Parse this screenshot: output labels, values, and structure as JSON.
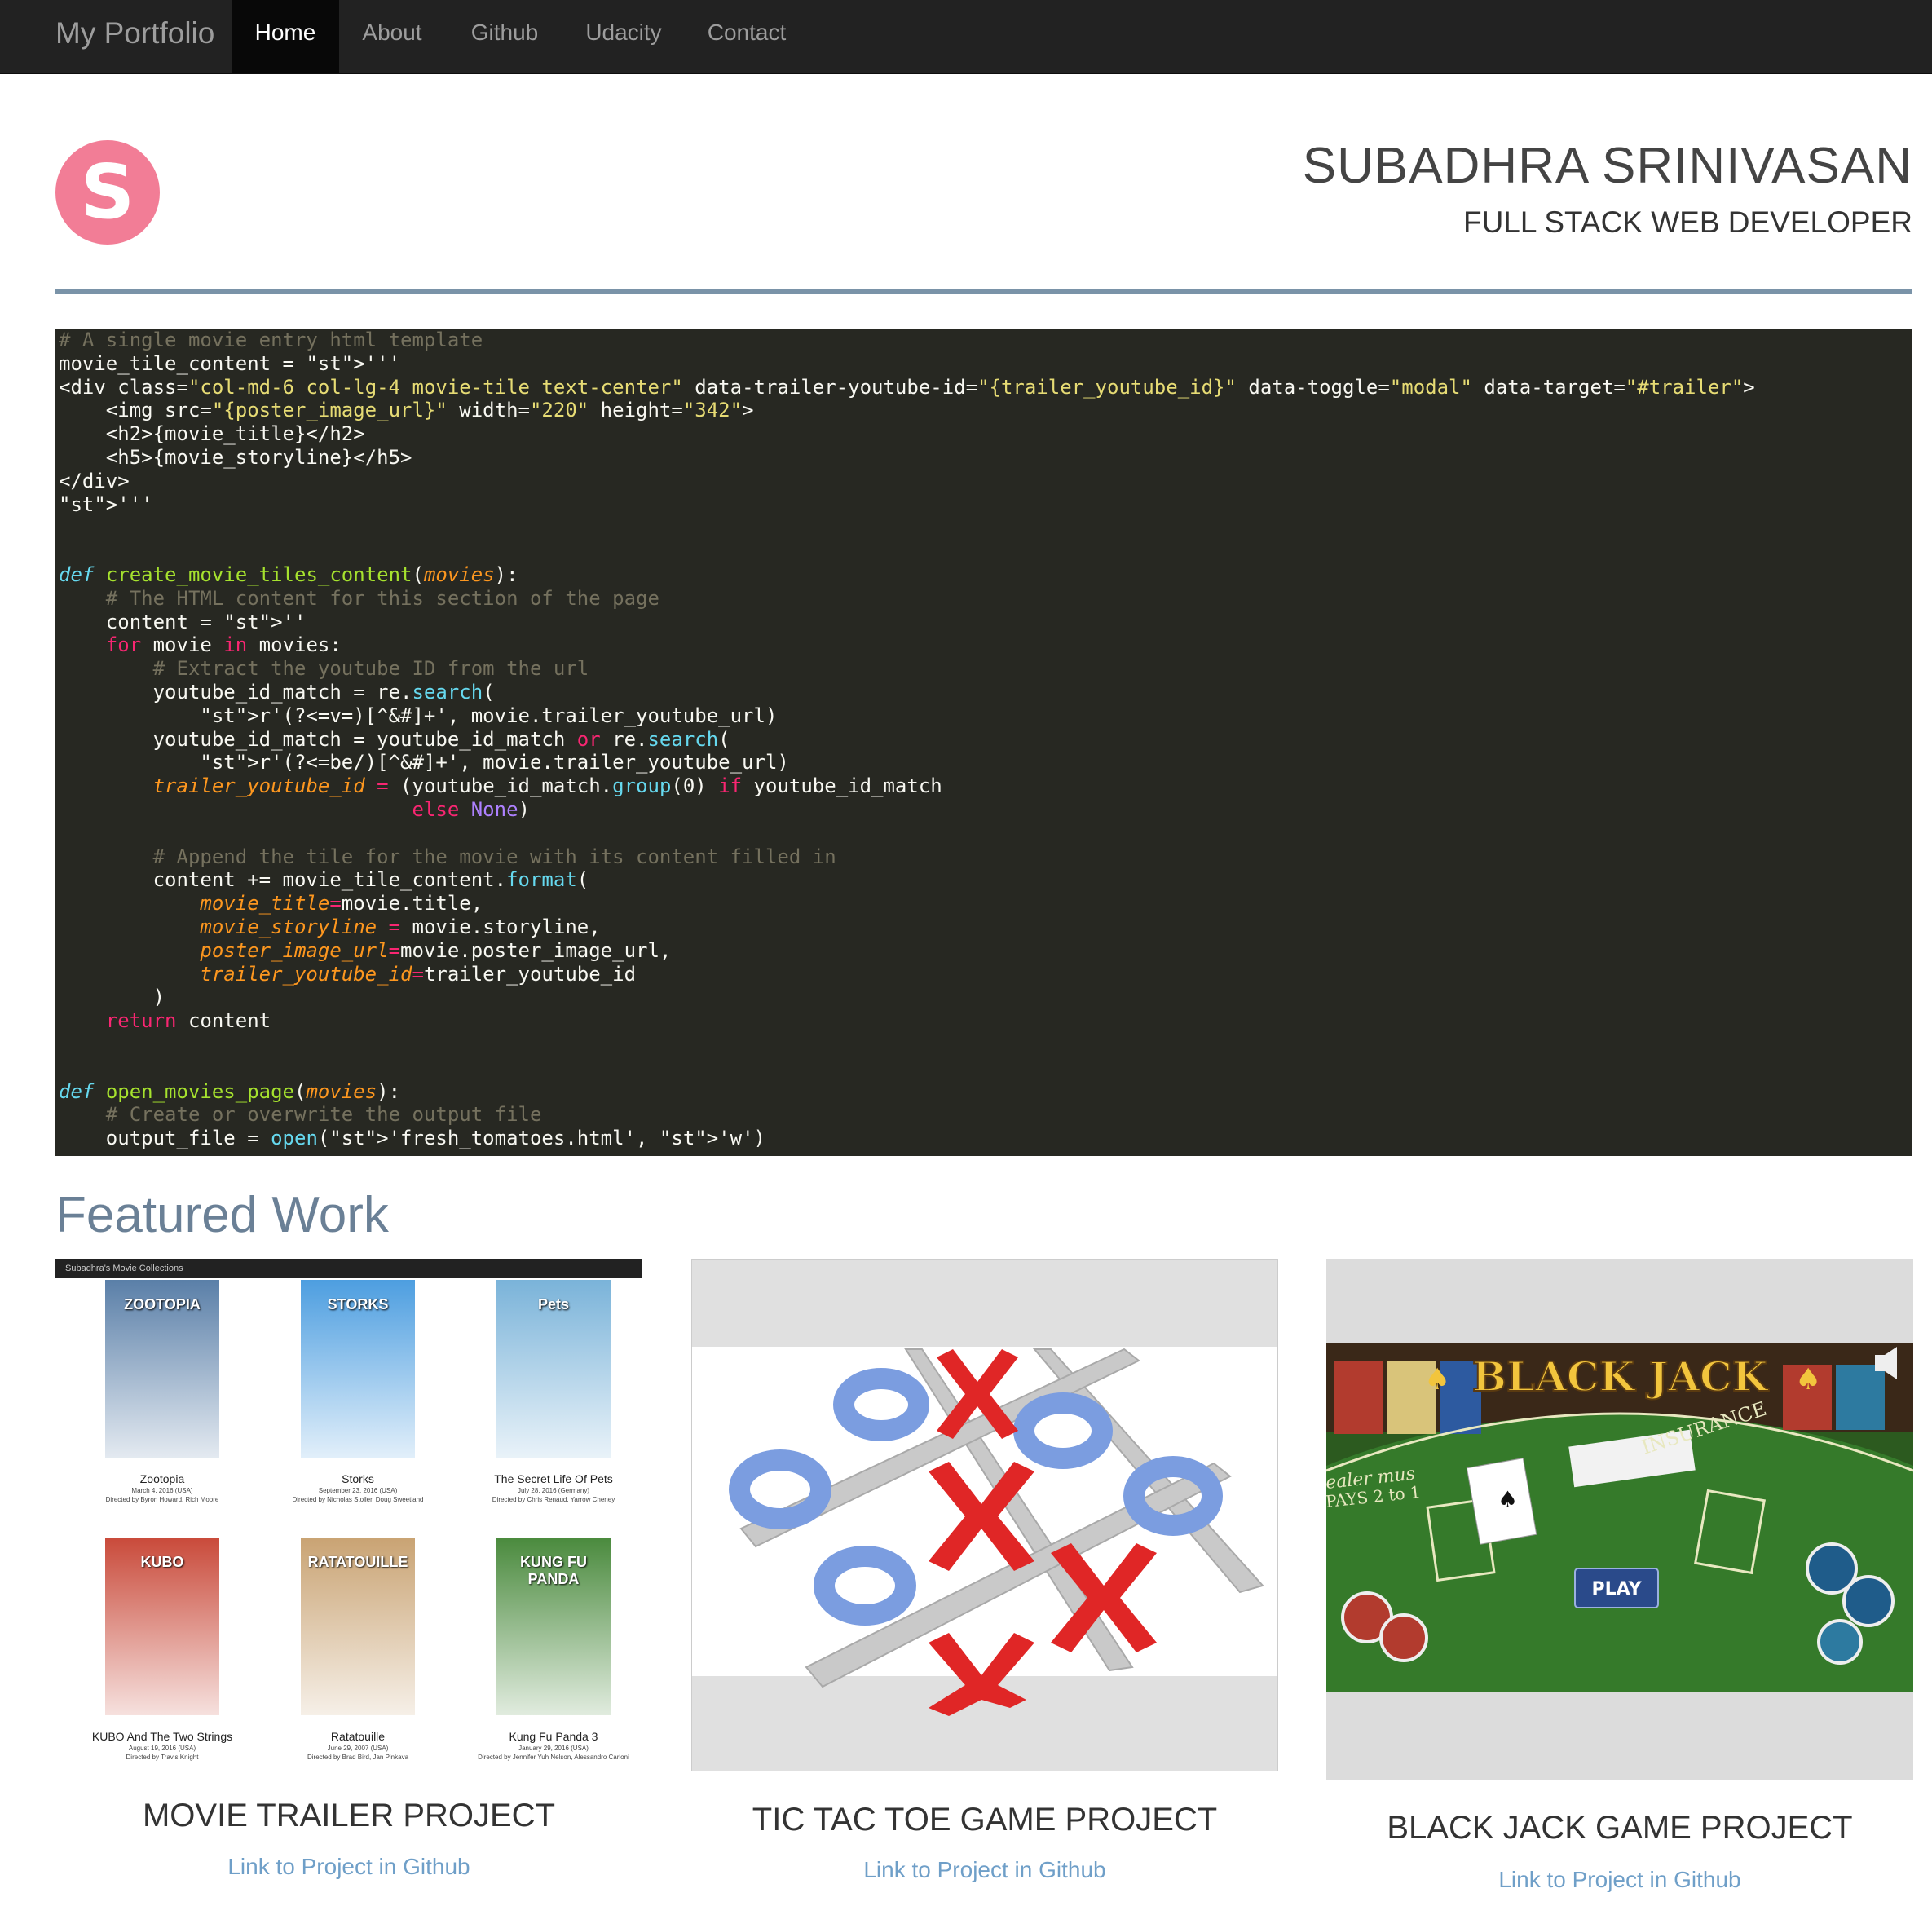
{
  "nav": {
    "brand": "My Portfolio",
    "items": [
      {
        "label": "Home",
        "active": true
      },
      {
        "label": "About"
      },
      {
        "label": "Github"
      },
      {
        "label": "Udacity"
      },
      {
        "label": "Contact"
      }
    ]
  },
  "header": {
    "avatar_letter": "S",
    "avatar_color": "#f27d96",
    "name": "SUBADHRA SRINIVASAN",
    "role": "FULL STACK WEB DEVELOPER"
  },
  "code_lines": [
    "# A single movie entry html template",
    "movie_tile_content = '''",
    "<div class=\"col-md-6 col-lg-4 movie-tile text-center\" data-trailer-youtube-id=\"{trailer_youtube_id}\" data-toggle=\"modal\" data-target=\"#trailer\">",
    "    <img src=\"{poster_image_url}\" width=\"220\" height=\"342\">",
    "    <h2>{movie_title}</h2>",
    "    <h5>{movie_storyline}</h5>",
    "</div>",
    "'''",
    "",
    "",
    "def create_movie_tiles_content(movies):",
    "    # The HTML content for this section of the page",
    "    content = ''",
    "    for movie in movies:",
    "        # Extract the youtube ID from the url",
    "        youtube_id_match = re.search(",
    "            r'(?<=v=)[^&#]+', movie.trailer_youtube_url)",
    "        youtube_id_match = youtube_id_match or re.search(",
    "            r'(?<=be/)[^&#]+', movie.trailer_youtube_url)",
    "        trailer_youtube_id = (youtube_id_match.group(0) if youtube_id_match",
    "                              else None)",
    "",
    "        # Append the tile for the movie with its content filled in",
    "        content += movie_tile_content.format(",
    "            movie_title=movie.title,",
    "            movie_storyline = movie.storyline,",
    "            poster_image_url=movie.poster_image_url,",
    "            trailer_youtube_id=trailer_youtube_id",
    "        )",
    "    return content",
    "",
    "",
    "def open_movies_page(movies):",
    "    # Create or overwrite the output file",
    "    output_file = open('fresh_tomatoes.html', 'w')"
  ],
  "featured": {
    "title": "Featured Work",
    "projects": [
      {
        "title": "MOVIE TRAILER PROJECT",
        "link": "Link to Project in Github",
        "image": {
          "bar_title": "Subadhra's Movie Collections",
          "movies": [
            {
              "title": "Zootopia",
              "date": "March 4, 2016 (USA)",
              "dir": "Directed by Byron Howard, Rich Moore",
              "poster": "ZOOTOPIA",
              "color": "#5a7fa8"
            },
            {
              "title": "Storks",
              "date": "September 23, 2016 (USA)",
              "dir": "Directed by Nicholas Stoller, Doug Sweetland",
              "poster": "STORKS",
              "color": "#4d9ee0"
            },
            {
              "title": "The Secret Life Of Pets",
              "date": "July 28, 2016 (Germany)",
              "dir": "Directed by Chris Renaud, Yarrow Cheney",
              "poster": "Pets",
              "color": "#7ab3d9"
            },
            {
              "title": "KUBO And The Two Strings",
              "date": "August 19, 2016 (USA)",
              "dir": "Directed by Travis Knight",
              "poster": "KUBO",
              "color": "#c94a3a"
            },
            {
              "title": "Ratatouille",
              "date": "June 29, 2007 (USA)",
              "dir": "Directed by Brad Bird, Jan Pinkava",
              "poster": "RATATOUILLE",
              "color": "#c9a373"
            },
            {
              "title": "Kung Fu Panda 3",
              "date": "January 29, 2016 (USA)",
              "dir": "Directed by Jennifer Yuh Nelson, Alessandro Carloni",
              "poster": "KUNG FU PANDA",
              "color": "#4a8a3d"
            }
          ]
        }
      },
      {
        "title": "TIC TAC TOE GAME PROJECT",
        "link": "Link to Project in Github"
      },
      {
        "title": "BLACK JACK GAME PROJECT",
        "link": "Link to Project in Github",
        "image": {
          "banner": "BLACK JACK",
          "play": "PLAY",
          "felt_text_1": "INSURANCE",
          "felt_text_2": "PAYS 2 to 1",
          "felt_text_3": "ealer mus"
        }
      }
    ]
  },
  "colors": {
    "navbar": "#222222",
    "code_bg": "#272822",
    "accent_rule": "#7a93a8",
    "link": "#6f9fc8"
  }
}
